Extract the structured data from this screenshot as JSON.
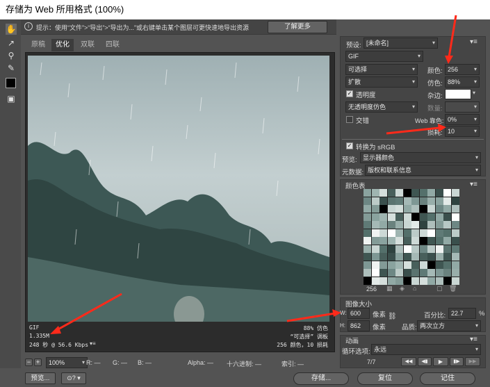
{
  "window": {
    "title": "存储为 Web 所用格式 (100%)"
  },
  "hint": {
    "text": "提示：使用“文件”>“导出”>“导出为...”或右键单击某个图层可更快速地导出资源",
    "button": "了解更多"
  },
  "tabs": [
    "原稿",
    "优化",
    "双联",
    "四联"
  ],
  "active_tab": 1,
  "preview_info": {
    "format": "GIF",
    "size": "1.335M",
    "time": "248 秒 @ 56.6 Kbps",
    "quality": "88% 仿色",
    "palette": "“可选择” 调板",
    "colors_lossy": "256 颜色，10 损耗"
  },
  "status": {
    "zoom": "100%",
    "r": "R: —",
    "g": "G: —",
    "b": "B: —",
    "alpha": "Alpha: —",
    "hex": "十六进制: —",
    "index": "索引: —"
  },
  "settings": {
    "preset_label": "预设:",
    "preset_value": "[未命名]",
    "format": "GIF",
    "palette": "可选择",
    "colors_label": "颜色:",
    "colors_value": "256",
    "dither_algo": "扩散",
    "dither_label": "仿色:",
    "dither_value": "88%",
    "transparency_label": "透明度",
    "matte_label": "杂边:",
    "trans_dither": "无透明度仿色",
    "amount_label": "数量:",
    "interlaced_label": "交错",
    "websnap_label": "Web 靠色:",
    "websnap_value": "0%",
    "lossy_label": "损耗:",
    "lossy_value": "10",
    "srgb_label": "转换为 sRGB",
    "preview_label": "预览:",
    "preview_value": "显示器颜色",
    "metadata_label": "元数据:",
    "metadata_value": "版权和联系信息"
  },
  "color_table": {
    "title": "颜色表",
    "count": "256",
    "swatches": [
      "#8aa39f",
      "#b7c8c5",
      "#5f7a76",
      "#c9d6d3",
      "#3f5652",
      "#9fb5b1",
      "#e3eae8",
      "#6d8784",
      "#a5b9b6",
      "#54706b",
      "#d5dfdc",
      "#7e9794",
      "#2f4340",
      "#bccbc8",
      "#91a9a5",
      "#485f5b",
      "#f0f3f2",
      "#6a827e",
      "#aebfbc",
      "#3a4f4c",
      "#cdd9d6",
      "#839b97",
      "#5a736f",
      "#98aeaa",
      "#ffffff",
      "#000000"
    ]
  },
  "image_size": {
    "title": "图像大小",
    "w_label": "W:",
    "w_value": "600",
    "h_label": "H:",
    "h_value": "862",
    "unit": "像素",
    "percent_label": "百分比:",
    "percent_value": "22.7",
    "percent_unit": "%",
    "quality_label": "品质:",
    "quality_value": "两次立方"
  },
  "animation": {
    "title": "动画",
    "loop_label": "循环选项:",
    "loop_value": "永远",
    "frame": "7/7"
  },
  "buttons": {
    "preview": "预览...",
    "save": "存储...",
    "reset": "复位",
    "remember": "记住"
  },
  "accent": {
    "annotation": "#ff2a1a",
    "selected": "#4e79c4"
  }
}
